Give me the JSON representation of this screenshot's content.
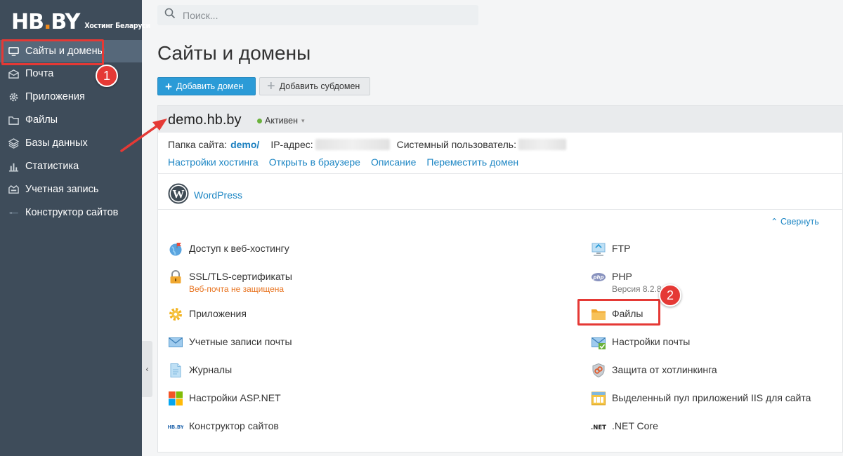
{
  "logo": {
    "main": "HB",
    "dot": ".",
    "tld": "BY",
    "subtitle": "Хостинг Беларуси"
  },
  "sidebar": {
    "items": [
      {
        "label": "Сайты и домены",
        "icon": "monitor-icon",
        "active": true
      },
      {
        "label": "Почта",
        "icon": "envelope-icon"
      },
      {
        "label": "Приложения",
        "icon": "gear-icon"
      },
      {
        "label": "Файлы",
        "icon": "folder-icon"
      },
      {
        "label": "Базы данных",
        "icon": "layers-icon"
      },
      {
        "label": "Статистика",
        "icon": "bar-chart-icon"
      },
      {
        "label": "Учетная запись",
        "icon": "account-icon"
      },
      {
        "label": "Конструктор сайтов",
        "icon": "site-builder-icon"
      }
    ],
    "collapse_glyph": "‹"
  },
  "search": {
    "placeholder": "Поиск..."
  },
  "page": {
    "title": "Сайты и домены"
  },
  "toolbar": {
    "add_domain_label": "Добавить домен",
    "add_subdomain_label": "Добавить субдомен"
  },
  "domain": {
    "name": "demo.hb.by",
    "status": "Активен",
    "folder_label": "Папка сайта:",
    "folder_value": "demo/",
    "ip_label": "IP-адрес:",
    "sys_user_label": "Системный пользователь:",
    "links": [
      "Настройки хостинга",
      "Открыть в браузере",
      "Описание",
      "Переместить домен"
    ],
    "app": "WordPress",
    "collapse_label": "Свернуть"
  },
  "tools": {
    "left": [
      {
        "label": "Доступ к веб-хостингу",
        "icon": "globe-flag-icon"
      },
      {
        "label": "SSL/TLS-сертификаты",
        "icon": "lock-icon",
        "sub": "Веб-почта не защищена"
      },
      {
        "label": "Приложения",
        "icon": "gear-icon"
      },
      {
        "label": "Учетные записи почты",
        "icon": "envelope-icon"
      },
      {
        "label": "Журналы",
        "icon": "document-icon"
      },
      {
        "label": "Настройки ASP.NET",
        "icon": "windows-icon"
      },
      {
        "label": "Конструктор сайтов",
        "icon": "hbby-icon",
        "icon_text": "HB.BY"
      }
    ],
    "right": [
      {
        "label": "FTP",
        "icon": "ftp-icon"
      },
      {
        "label": "PHP",
        "icon": "php-icon",
        "icon_text": "php",
        "sub": "Версия 8.2.8"
      },
      {
        "label": "Файлы",
        "icon": "folder-icon"
      },
      {
        "label": "Настройки почты",
        "icon": "mail-settings-icon"
      },
      {
        "label": "Защита от хотлинкинга",
        "icon": "shield-link-icon"
      },
      {
        "label": "Выделенный пул приложений IIS для сайта",
        "icon": "iis-pool-icon"
      },
      {
        "label": ".NET Core",
        "icon": "dotnet-icon",
        "icon_text": ".NET"
      }
    ]
  },
  "annotations": {
    "badge1": "1",
    "badge2": "2",
    "accent": "#e53935"
  },
  "colors": {
    "sidebar": "#3e4c5a",
    "sidebar_active": "#56687a",
    "primary": "#2b9bd7",
    "link": "#1d86c4",
    "warning": "#e8731f",
    "status_active": "#6ab23c"
  }
}
